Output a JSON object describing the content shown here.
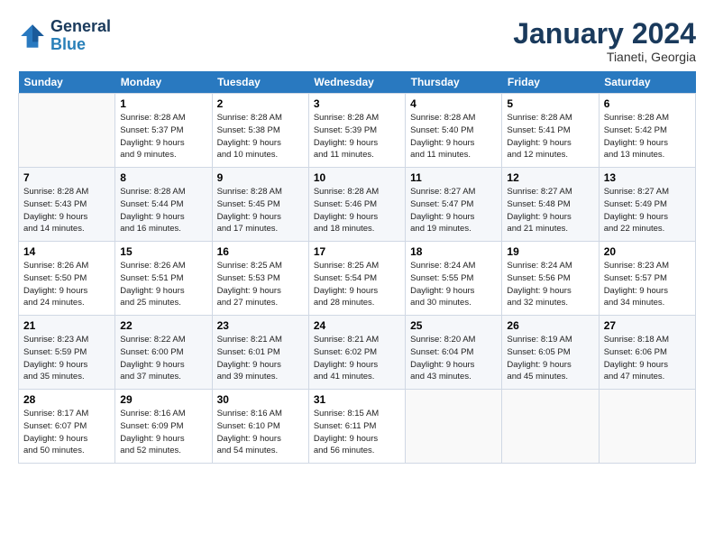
{
  "logo": {
    "line1": "General",
    "line2": "Blue"
  },
  "title": "January 2024",
  "location": "Tianeti, Georgia",
  "days_header": [
    "Sunday",
    "Monday",
    "Tuesday",
    "Wednesday",
    "Thursday",
    "Friday",
    "Saturday"
  ],
  "weeks": [
    [
      {
        "day": "",
        "info": ""
      },
      {
        "day": "1",
        "info": "Sunrise: 8:28 AM\nSunset: 5:37 PM\nDaylight: 9 hours\nand 9 minutes."
      },
      {
        "day": "2",
        "info": "Sunrise: 8:28 AM\nSunset: 5:38 PM\nDaylight: 9 hours\nand 10 minutes."
      },
      {
        "day": "3",
        "info": "Sunrise: 8:28 AM\nSunset: 5:39 PM\nDaylight: 9 hours\nand 11 minutes."
      },
      {
        "day": "4",
        "info": "Sunrise: 8:28 AM\nSunset: 5:40 PM\nDaylight: 9 hours\nand 11 minutes."
      },
      {
        "day": "5",
        "info": "Sunrise: 8:28 AM\nSunset: 5:41 PM\nDaylight: 9 hours\nand 12 minutes."
      },
      {
        "day": "6",
        "info": "Sunrise: 8:28 AM\nSunset: 5:42 PM\nDaylight: 9 hours\nand 13 minutes."
      }
    ],
    [
      {
        "day": "7",
        "info": "Sunrise: 8:28 AM\nSunset: 5:43 PM\nDaylight: 9 hours\nand 14 minutes."
      },
      {
        "day": "8",
        "info": "Sunrise: 8:28 AM\nSunset: 5:44 PM\nDaylight: 9 hours\nand 16 minutes."
      },
      {
        "day": "9",
        "info": "Sunrise: 8:28 AM\nSunset: 5:45 PM\nDaylight: 9 hours\nand 17 minutes."
      },
      {
        "day": "10",
        "info": "Sunrise: 8:28 AM\nSunset: 5:46 PM\nDaylight: 9 hours\nand 18 minutes."
      },
      {
        "day": "11",
        "info": "Sunrise: 8:27 AM\nSunset: 5:47 PM\nDaylight: 9 hours\nand 19 minutes."
      },
      {
        "day": "12",
        "info": "Sunrise: 8:27 AM\nSunset: 5:48 PM\nDaylight: 9 hours\nand 21 minutes."
      },
      {
        "day": "13",
        "info": "Sunrise: 8:27 AM\nSunset: 5:49 PM\nDaylight: 9 hours\nand 22 minutes."
      }
    ],
    [
      {
        "day": "14",
        "info": "Sunrise: 8:26 AM\nSunset: 5:50 PM\nDaylight: 9 hours\nand 24 minutes."
      },
      {
        "day": "15",
        "info": "Sunrise: 8:26 AM\nSunset: 5:51 PM\nDaylight: 9 hours\nand 25 minutes."
      },
      {
        "day": "16",
        "info": "Sunrise: 8:25 AM\nSunset: 5:53 PM\nDaylight: 9 hours\nand 27 minutes."
      },
      {
        "day": "17",
        "info": "Sunrise: 8:25 AM\nSunset: 5:54 PM\nDaylight: 9 hours\nand 28 minutes."
      },
      {
        "day": "18",
        "info": "Sunrise: 8:24 AM\nSunset: 5:55 PM\nDaylight: 9 hours\nand 30 minutes."
      },
      {
        "day": "19",
        "info": "Sunrise: 8:24 AM\nSunset: 5:56 PM\nDaylight: 9 hours\nand 32 minutes."
      },
      {
        "day": "20",
        "info": "Sunrise: 8:23 AM\nSunset: 5:57 PM\nDaylight: 9 hours\nand 34 minutes."
      }
    ],
    [
      {
        "day": "21",
        "info": "Sunrise: 8:23 AM\nSunset: 5:59 PM\nDaylight: 9 hours\nand 35 minutes."
      },
      {
        "day": "22",
        "info": "Sunrise: 8:22 AM\nSunset: 6:00 PM\nDaylight: 9 hours\nand 37 minutes."
      },
      {
        "day": "23",
        "info": "Sunrise: 8:21 AM\nSunset: 6:01 PM\nDaylight: 9 hours\nand 39 minutes."
      },
      {
        "day": "24",
        "info": "Sunrise: 8:21 AM\nSunset: 6:02 PM\nDaylight: 9 hours\nand 41 minutes."
      },
      {
        "day": "25",
        "info": "Sunrise: 8:20 AM\nSunset: 6:04 PM\nDaylight: 9 hours\nand 43 minutes."
      },
      {
        "day": "26",
        "info": "Sunrise: 8:19 AM\nSunset: 6:05 PM\nDaylight: 9 hours\nand 45 minutes."
      },
      {
        "day": "27",
        "info": "Sunrise: 8:18 AM\nSunset: 6:06 PM\nDaylight: 9 hours\nand 47 minutes."
      }
    ],
    [
      {
        "day": "28",
        "info": "Sunrise: 8:17 AM\nSunset: 6:07 PM\nDaylight: 9 hours\nand 50 minutes."
      },
      {
        "day": "29",
        "info": "Sunrise: 8:16 AM\nSunset: 6:09 PM\nDaylight: 9 hours\nand 52 minutes."
      },
      {
        "day": "30",
        "info": "Sunrise: 8:16 AM\nSunset: 6:10 PM\nDaylight: 9 hours\nand 54 minutes."
      },
      {
        "day": "31",
        "info": "Sunrise: 8:15 AM\nSunset: 6:11 PM\nDaylight: 9 hours\nand 56 minutes."
      },
      {
        "day": "",
        "info": ""
      },
      {
        "day": "",
        "info": ""
      },
      {
        "day": "",
        "info": ""
      }
    ]
  ]
}
